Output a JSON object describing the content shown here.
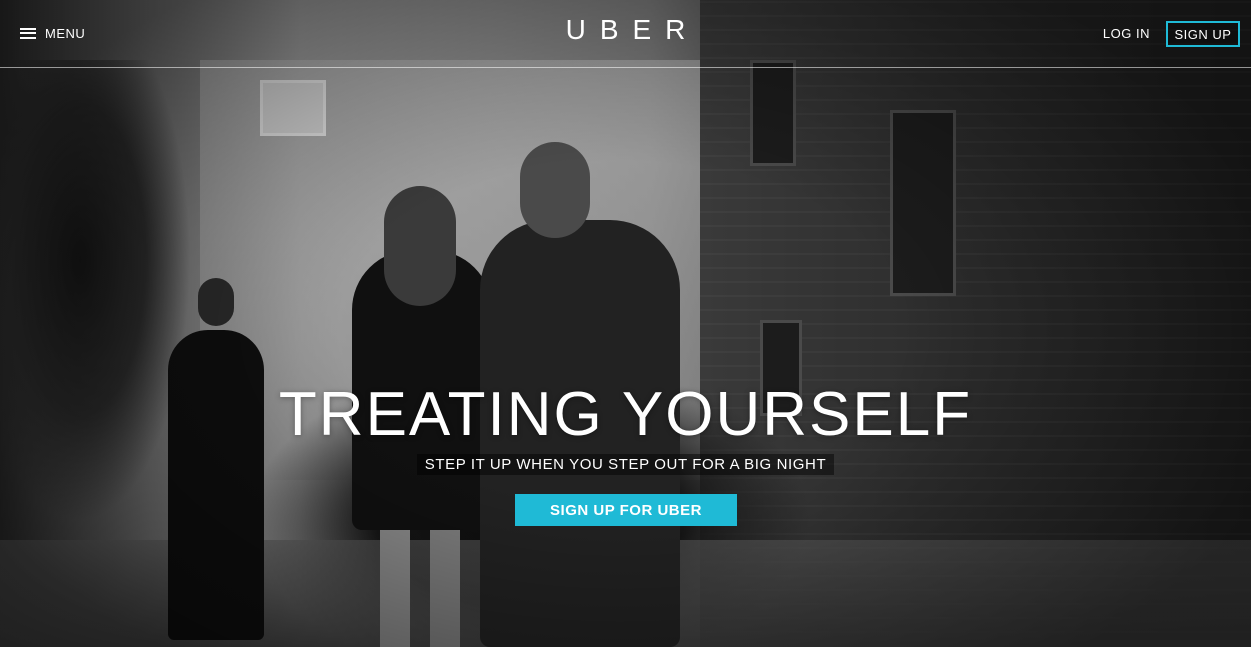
{
  "nav": {
    "menu_label": "MENU",
    "logo_text": "UBER",
    "login_label": "LOG IN",
    "signup_label": "SIGN UP"
  },
  "hero": {
    "headline": "TREATING YOURSELF",
    "subline": "STEP IT UP WHEN YOU STEP OUT FOR A BIG NIGHT",
    "cta_label": "SIGN UP FOR UBER",
    "background": "black-and-white photo of a couple walking in an alley next to a car and a chauffeur"
  },
  "colors": {
    "accent": "#1fbad6",
    "text": "#ffffff"
  },
  "icons": {
    "menu": "hamburger-icon"
  }
}
